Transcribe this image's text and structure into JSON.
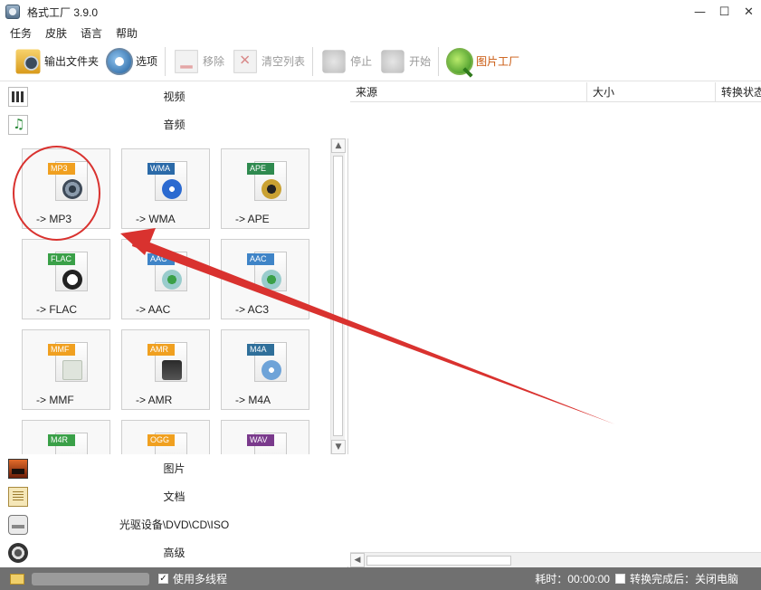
{
  "window": {
    "title": "格式工厂 3.9.0",
    "min": "—",
    "max": "☐",
    "close": "✕"
  },
  "menu": [
    "任务",
    "皮肤",
    "语言",
    "帮助"
  ],
  "toolbar": {
    "output_folder": "输出文件夹",
    "options": "选项",
    "remove": "移除",
    "clear_list": "清空列表",
    "stop": "停止",
    "start": "开始",
    "picture_factory": "图片工厂"
  },
  "categories": {
    "video": "视频",
    "audio": "音频",
    "picture": "图片",
    "document": "文档",
    "disc": "光驱设备\\DVD\\CD\\ISO",
    "advanced": "高级"
  },
  "formats": [
    {
      "badge": "MP3",
      "label": "-> MP3",
      "badge_color": "#f0a020",
      "glyph_color": "#6b7b8c"
    },
    {
      "badge": "WMA",
      "label": "-> WMA",
      "badge_color": "#2b6aa8",
      "glyph_color": "#2b6ad0"
    },
    {
      "badge": "APE",
      "label": "-> APE",
      "badge_color": "#2f8a4f",
      "glyph_color": "#c9a132"
    },
    {
      "badge": "FLAC",
      "label": "-> FLAC",
      "badge_color": "#3aa048",
      "glyph_color": "#222222"
    },
    {
      "badge": "AAC",
      "label": "-> AAC",
      "badge_color": "#3f84c7",
      "glyph_color": "#3aa048"
    },
    {
      "badge": "AAC",
      "label": "-> AC3",
      "badge_color": "#3f84c7",
      "glyph_color": "#3aa048"
    },
    {
      "badge": "MMF",
      "label": "-> MMF",
      "badge_color": "#f0a020",
      "glyph_color": "#dfe4dc"
    },
    {
      "badge": "AMR",
      "label": "-> AMR",
      "badge_color": "#f0a020",
      "glyph_color": "#2a2a2a"
    },
    {
      "badge": "M4A",
      "label": "-> M4A",
      "badge_color": "#2f6f9a",
      "glyph_color": "#6ea3d8"
    },
    {
      "badge": "M4R",
      "label": "",
      "badge_color": "#3aa048",
      "glyph_color": "#777777"
    },
    {
      "badge": "OGG",
      "label": "",
      "badge_color": "#f0a020",
      "glyph_color": "#3f84c7"
    },
    {
      "badge": "WAV",
      "label": "",
      "badge_color": "#7a3a8c",
      "glyph_color": "#555555"
    }
  ],
  "list_columns": [
    "来源",
    "大小",
    "转换状态"
  ],
  "status": {
    "multithread": "使用多线程",
    "elapsed_label": "耗时：00:00:00",
    "after_convert": "转换完成后：关闭电脑"
  },
  "colors": {
    "annotation": "#d9322f",
    "statusbar": "#707070"
  }
}
